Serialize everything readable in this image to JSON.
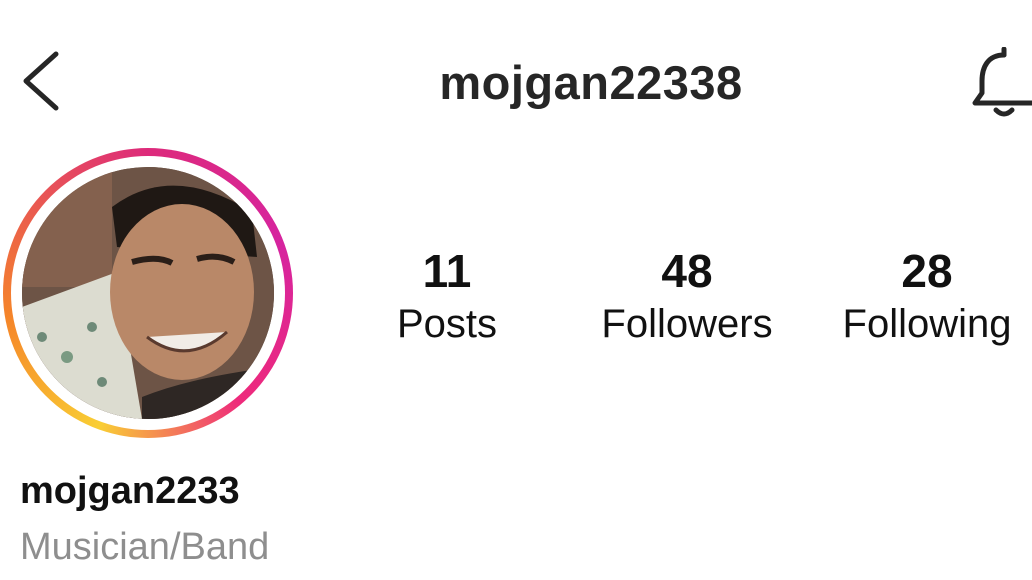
{
  "header": {
    "title": "mojgan22338"
  },
  "icons": {
    "back": "chevron-left-icon",
    "notifications": "bell-icon"
  },
  "stats": [
    {
      "value": "11",
      "label": "Posts"
    },
    {
      "value": "48",
      "label": "Followers"
    },
    {
      "value": "28",
      "label": "Following"
    }
  ],
  "profile": {
    "username": "mojgan2233",
    "category": "Musician/Band"
  },
  "colors": {
    "text": "#262626",
    "muted": "#8e8e8e",
    "ring_start": "#f9ce34",
    "ring_end": "#d6249f"
  }
}
